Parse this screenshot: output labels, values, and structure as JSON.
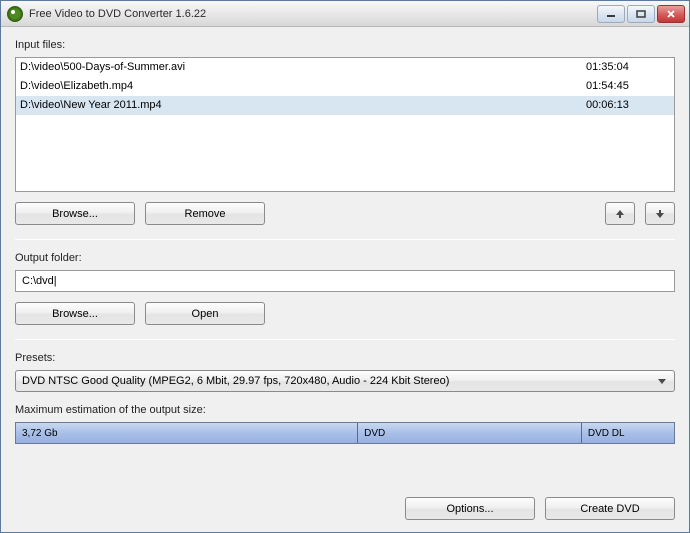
{
  "titlebar": {
    "title": "Free Video to DVD Converter 1.6.22"
  },
  "input": {
    "label": "Input files:",
    "files": [
      {
        "path": "D:\\video\\500-Days-of-Summer.avi",
        "duration": "01:35:04",
        "selected": false
      },
      {
        "path": "D:\\video\\Elizabeth.mp4",
        "duration": "01:54:45",
        "selected": false
      },
      {
        "path": "D:\\video\\New Year 2011.mp4",
        "duration": "00:06:13",
        "selected": true
      }
    ],
    "browse": "Browse...",
    "remove": "Remove"
  },
  "output": {
    "label": "Output folder:",
    "path": "C:\\dvd|",
    "browse": "Browse...",
    "open": "Open"
  },
  "presets": {
    "label": "Presets:",
    "selected": "DVD NTSC Good Quality (MPEG2, 6 Mbit, 29.97 fps, 720x480, Audio - 224 Kbit Stereo)"
  },
  "estimation": {
    "label": "Maximum estimation of the output size:",
    "size_text": "3,72 Gb",
    "marker_dvd": "DVD",
    "marker_dvddl": "DVD DL"
  },
  "buttons": {
    "options": "Options...",
    "create": "Create DVD"
  }
}
